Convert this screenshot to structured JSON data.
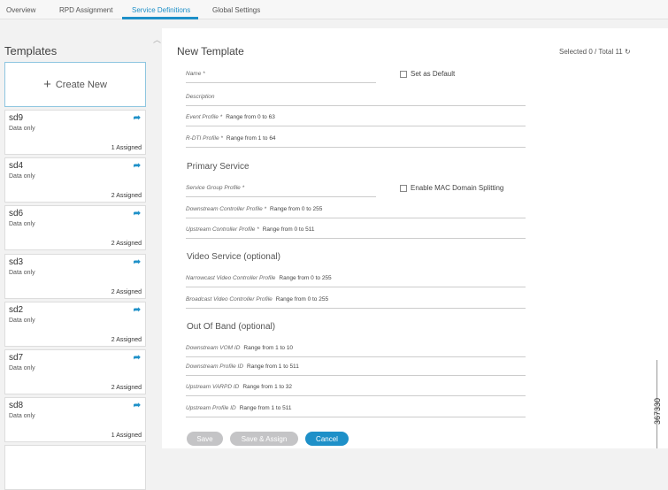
{
  "tabs": [
    "Overview",
    "RPD Assignment",
    "Service Definitions",
    "Global Settings"
  ],
  "sidebar": {
    "title": "Templates",
    "create_label": "Create New",
    "templates": [
      {
        "name": "sd9",
        "type": "Data only",
        "assigned": "1 Assigned"
      },
      {
        "name": "sd4",
        "type": "Data only",
        "assigned": "2 Assigned"
      },
      {
        "name": "sd6",
        "type": "Data only",
        "assigned": "2 Assigned"
      },
      {
        "name": "sd3",
        "type": "Data only",
        "assigned": "2 Assigned"
      },
      {
        "name": "sd2",
        "type": "Data only",
        "assigned": "2 Assigned"
      },
      {
        "name": "sd7",
        "type": "Data only",
        "assigned": "2 Assigned"
      },
      {
        "name": "sd8",
        "type": "Data only",
        "assigned": "1 Assigned"
      }
    ]
  },
  "form": {
    "title": "New Template",
    "count": "Selected 0 / Total 11",
    "set_default": "Set as Default",
    "mac_split": "Enable MAC Domain Splitting",
    "sections": {
      "primary": "Primary Service",
      "video": "Video Service (optional)",
      "oob": "Out Of Band (optional)"
    },
    "fields": [
      {
        "label": "Name *",
        "hint": ""
      },
      {
        "label": "Description",
        "hint": ""
      },
      {
        "label": "Event Profile *",
        "hint": "Range from 0 to 63"
      },
      {
        "label": "R-DTI Profile *",
        "hint": "Range from 1 to 64"
      },
      {
        "label": "Service Group Profile *",
        "hint": ""
      },
      {
        "label": "Downstream Controller Profile *",
        "hint": "Range from 0 to 255"
      },
      {
        "label": "Upstream Controller Profile *",
        "hint": "Range from 0 to 511"
      },
      {
        "label": "Narrowcast Video Controller Profile",
        "hint": "Range from 0 to 255"
      },
      {
        "label": "Broadcast Video Controller Profile",
        "hint": "Range from 0 to 255"
      },
      {
        "label": "Downstream VOM ID",
        "hint": "Range from 1 to 10"
      },
      {
        "label": "Downstream Profile ID",
        "hint": "Range from 1 to 511"
      },
      {
        "label": "Upstream VARPD ID",
        "hint": "Range from 1 to 32"
      },
      {
        "label": "Upstream Profile ID",
        "hint": "Range from 1 to 511"
      }
    ],
    "buttons": {
      "save": "Save",
      "save_assign": "Save & Assign",
      "cancel": "Cancel"
    }
  },
  "figure_id": "367330"
}
